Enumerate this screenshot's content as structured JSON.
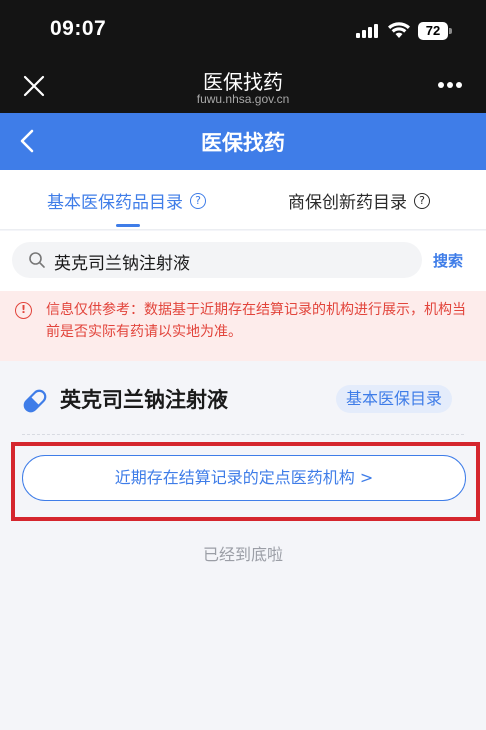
{
  "status_bar": {
    "time": "09:07",
    "battery": "72"
  },
  "browser": {
    "title": "医保找药",
    "url": "fuwu.nhsa.gov.cn"
  },
  "app_bar": {
    "title": "医保找药"
  },
  "tabs": [
    {
      "label": "基本医保药品目录",
      "active": true
    },
    {
      "label": "商保创新药目录",
      "active": false
    }
  ],
  "search": {
    "value": "英克司兰钠注射液",
    "button_label": "搜索"
  },
  "notice": {
    "text": "信息仅供参考：数据基于近期存在结算记录的机构进行展示，机构当前是否实际有药请以实地为准。"
  },
  "drug": {
    "name": "英克司兰钠注射液",
    "badge": "基本医保目录",
    "institutions_button": "近期存在结算记录的定点医药机构 >"
  },
  "end_text": "已经到底啦",
  "colors": {
    "accent": "#3f7de8",
    "notice": "#e2443b",
    "notice_bg": "#fdeceb",
    "highlight": "#d5262e",
    "header_bg": "#141414"
  },
  "icons": {
    "close": "close-icon",
    "more": "more-dots-icon",
    "back": "back-arrow-icon",
    "info": "info-icon",
    "search": "search-icon",
    "warning": "warning-icon",
    "pill": "pill-icon"
  }
}
